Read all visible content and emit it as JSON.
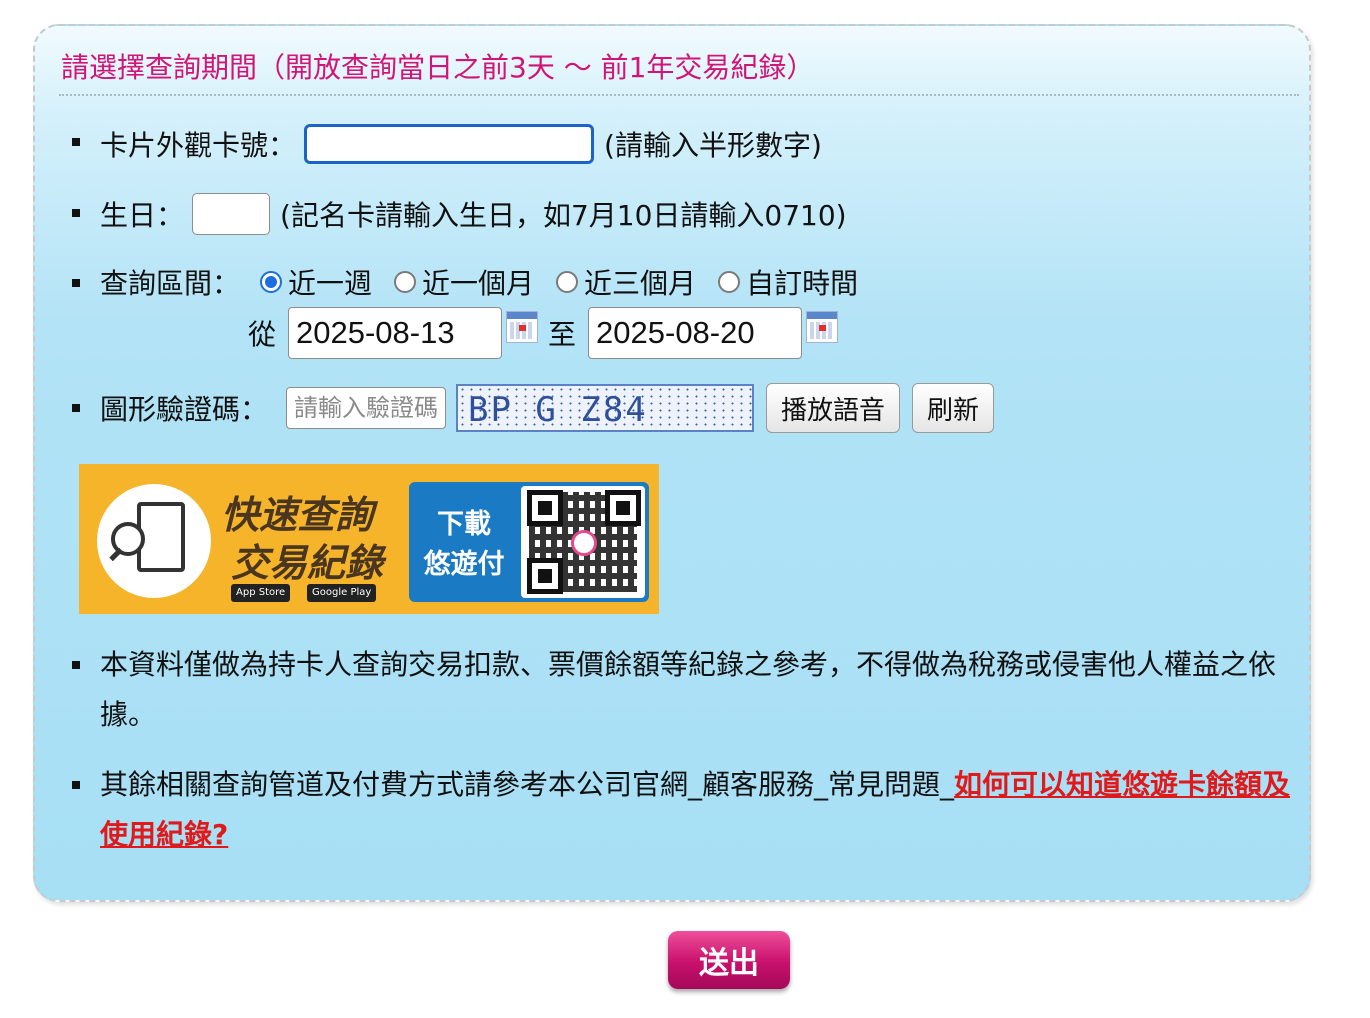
{
  "title": "請選擇查詢期間（開放查詢當日之前3天 ～ 前1年交易紀錄）",
  "card": {
    "label": "卡片外觀卡號：",
    "value": "",
    "hint": "(請輸入半形數字)"
  },
  "birthday": {
    "label": "生日：",
    "value": "",
    "hint": "(記名卡請輸入生日，如7月10日請輸入0710)"
  },
  "period": {
    "label": "查詢區間：",
    "options": [
      "近一週",
      "近一個月",
      "近三個月",
      "自訂時間"
    ],
    "selected": "近一週",
    "from_label": "從",
    "from_date": "2025-08-13",
    "to_label": "至",
    "to_date": "2025-08-20",
    "calendar_icon": "calendar-icon"
  },
  "captcha": {
    "label": "圖形驗證碼：",
    "placeholder": "請輸入驗證碼",
    "image_text": "BP G Z84",
    "play_label": "播放語音",
    "refresh_label": "刷新"
  },
  "banner": {
    "line1": "快速查詢",
    "line2": "交易紀錄",
    "download": "下載",
    "app_name": "悠遊付",
    "app_store": "App Store",
    "google_play": "Google Play"
  },
  "notes": {
    "disclaimer": "本資料僅做為持卡人查詢交易扣款、票價餘額等紀錄之參考，不得做為稅務或侵害他人權益之依據。",
    "other_prefix": "其餘相關查詢管道及付費方式請參考本公司官網_顧客服務_常見問題_",
    "other_link": "如何可以知道悠遊卡餘額及使用紀錄?"
  },
  "submit_label": "送出",
  "colors": {
    "title": "#d21377",
    "link": "#e0191a",
    "panel_bg": "#a7dff5",
    "submit": "#c8106c"
  }
}
